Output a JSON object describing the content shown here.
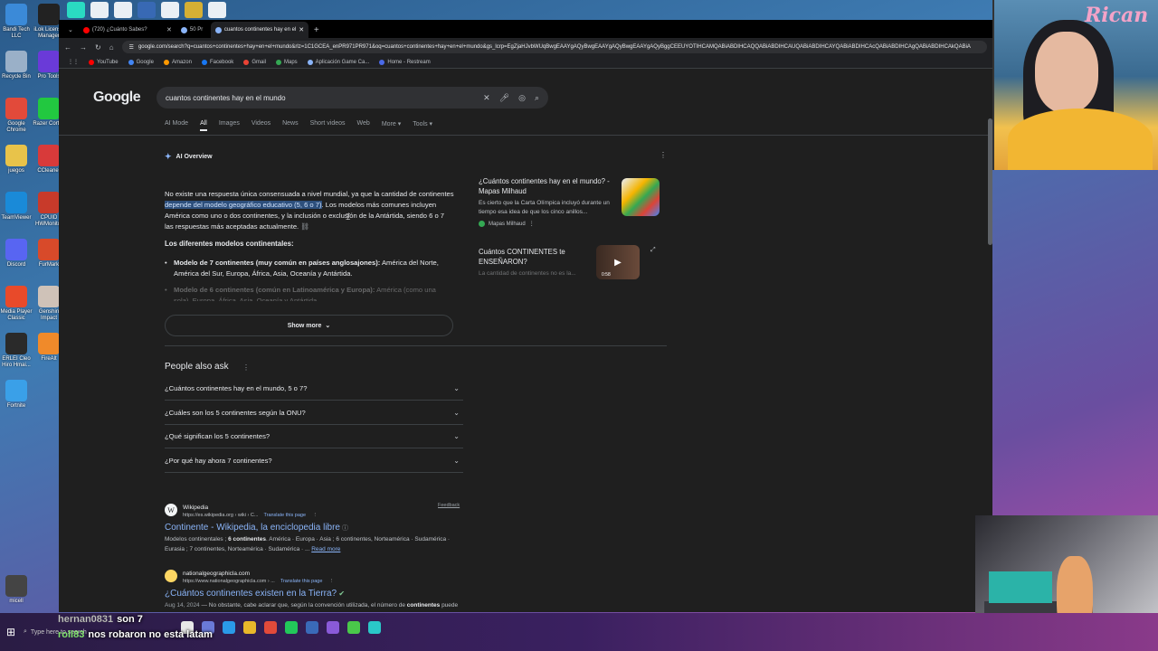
{
  "desktop": {
    "icons": [
      {
        "label": "Bandi Tech LLC",
        "color": "#3b8ad8"
      },
      {
        "label": "iLok License Manager",
        "color": "#222222"
      },
      {
        "label": "Recycle Bin",
        "color": "#9ab0c8"
      },
      {
        "label": "Pro Tools",
        "color": "#6a3ad8"
      },
      {
        "label": "Google Chrome",
        "color": "#e24a3a"
      },
      {
        "label": "Razer Cortex",
        "color": "#22c840"
      },
      {
        "label": "juegos",
        "color": "#e8c34a"
      },
      {
        "label": "CCleaner",
        "color": "#d83a3a"
      },
      {
        "label": "TeamViewer",
        "color": "#1a8ad8"
      },
      {
        "label": "CPUID HWMonitor",
        "color": "#c83a2a"
      },
      {
        "label": "Discord",
        "color": "#5865f2"
      },
      {
        "label": "FurMark",
        "color": "#d84a2a"
      },
      {
        "label": "Media Player Classic",
        "color": "#e84a2a"
      },
      {
        "label": "Genshin Impact",
        "color": "#cfc2b8"
      },
      {
        "label": "ERLEI Cleo Hiro Hmai...",
        "color": "#2a2a2a"
      },
      {
        "label": "FireAlt",
        "color": "#f08a2a"
      },
      {
        "label": "Fortnite",
        "color": "#3aa0e8"
      },
      {
        "label": "micell",
        "color": "#444444"
      }
    ],
    "top_apps": [
      "#2ae8c8",
      "#ffffff",
      "#ffffff",
      "#3a6ab8",
      "#ffffff",
      "#e8b82a",
      "#ffffff"
    ]
  },
  "browser": {
    "tabs": [
      {
        "label": "(720) ¿Cuánto Sabes?",
        "color": "#ff0000"
      },
      {
        "label": "50 Pr",
        "color": "#8ab4f8"
      },
      {
        "label": "cuantos continentes hay en el",
        "color": "#8ab4f8"
      }
    ],
    "url": "google.com/search?q=cuantos+continentes+hay+en+el+mundo&rlz=1C1GCEA_enPR971PR971&oq=cuantos+continentes+hay+en+el+mundo&gs_lcrp=EgZjaHJvbWUqBwgEAAYgAQyBwgEAAYgAQyBwgEAAYgAQyBggCEEUYOTIHCAMQABiABDIHCAQQABiABDIHCAUQABiABDIHCAYQABiABDIHCAcQABiABDIHCAgQABiABDIHCAkQABiA",
    "bookmarks": [
      {
        "label": "YouTube",
        "color": "#ff0000"
      },
      {
        "label": "Google",
        "color": "#4285f4"
      },
      {
        "label": "Amazon",
        "color": "#ff9900"
      },
      {
        "label": "Facebook",
        "color": "#1877f2"
      },
      {
        "label": "Gmail",
        "color": "#ea4335"
      },
      {
        "label": "Maps",
        "color": "#34a853"
      },
      {
        "label": "Aplicación Game Ca...",
        "color": "#8ab4f8"
      },
      {
        "label": "Home - Restream",
        "color": "#4a6ae8"
      }
    ],
    "new_tab": "+"
  },
  "google": {
    "logo": "Google",
    "query": "cuantos continentes hay en el mundo",
    "filters": [
      "AI Mode",
      "All",
      "Images",
      "Videos",
      "News",
      "Short videos",
      "Web",
      "More ▾",
      "Tools ▾"
    ],
    "ai": {
      "header": "AI Overview",
      "intro_1": "No existe una respuesta única consensuada a nivel mundial, ya que la cantidad de continentes ",
      "intro_highlight": "depende del modelo geográfico educativo (5, 6 o 7)",
      "intro_2": ". Los modelos más comunes incluyen América como uno o dos continentes, y la inclusión o exclusión de la Antártida, siendo 6 o 7 las respuestas más aceptadas actualmente.",
      "subhead": "Los diferentes modelos continentales:",
      "items": [
        {
          "bold": "Modelo de 7 continentes (muy común en países anglosajones):",
          "text": " América del Norte, América del Sur, Europa, África, Asia, Oceanía y Antártida."
        },
        {
          "bold": "Modelo de 6 continentes (común en Latinoamérica y Europa):",
          "text": " América (como una sola), Europa, África, Asia, Oceanía y Antártida."
        }
      ],
      "show_more": "Show more",
      "sources": [
        {
          "title": "¿Cuántos continentes hay en el mundo? - Mapas Milhaud",
          "snippet": "Es cierto que la Carta Olímpica incluyó durante un tiempo esa idea de que los cinco anillos...",
          "site": "Mapas Milhaud"
        },
        {
          "title": "Cuántos CONTINENTES te ENSEÑARON?",
          "snippet": "La cantidad de continentes no es la...",
          "duration": "0:58"
        }
      ]
    },
    "paa": {
      "title": "People also ask",
      "questions": [
        "¿Cuántos continentes hay en el mundo, 5 o 7?",
        "¿Cuáles son los 5 continentes según la ONU?",
        "¿Qué significan los 5 continentes?",
        "¿Por qué hay ahora 7 continentes?"
      ],
      "feedback": "Feedback"
    },
    "results": [
      {
        "site": "Wikipedia",
        "url": "https://es.wikipedia.org › wiki › C...",
        "translate": "Translate this page",
        "favicon": "W",
        "title": "Continente - Wikipedia, la enciclopedia libre",
        "snip_a": "Modelos continentales ; ",
        "snip_b": "6 continentes",
        "snip_c": ". América · Europa · Asia ; 6 continentes, Norteamérica · Sudamérica · Eurasia ; 7 continentes, Norteamérica · Sudamérica · ...",
        "read_more": "Read more"
      },
      {
        "site": "nationalgeographicla.com",
        "url": "https://www.nationalgeographicla.com › ...",
        "translate": "Translate this page",
        "favicon": "",
        "title": "¿Cuántos continentes existen en la Tierra?",
        "date": "Aug 14, 2024",
        "snip_a": " — No obstante, cabe aclarar que, según la convención utilizada, el número de ",
        "snip_b": "continentes",
        "snip_c": " puede variar de cinco a siete, aclara The World Factbook.",
        "read_more": "Read more"
      }
    ]
  },
  "taskbar": {
    "search_placeholder": "Type here to search",
    "apps": [
      "#e8e8e8",
      "#6a7ad8",
      "#2a9ae8",
      "#e8b82a",
      "#e24a3a",
      "#22c85a",
      "#3a6ab8",
      "#8a5ad8",
      "#4ac84a",
      "#2ac8c8"
    ]
  },
  "chat": [
    {
      "user": "hernan0831",
      "message": "son 7"
    },
    {
      "user": "roll83",
      "message": "nos robaron no esta latam"
    }
  ],
  "stream": {
    "channel": "Rican"
  }
}
